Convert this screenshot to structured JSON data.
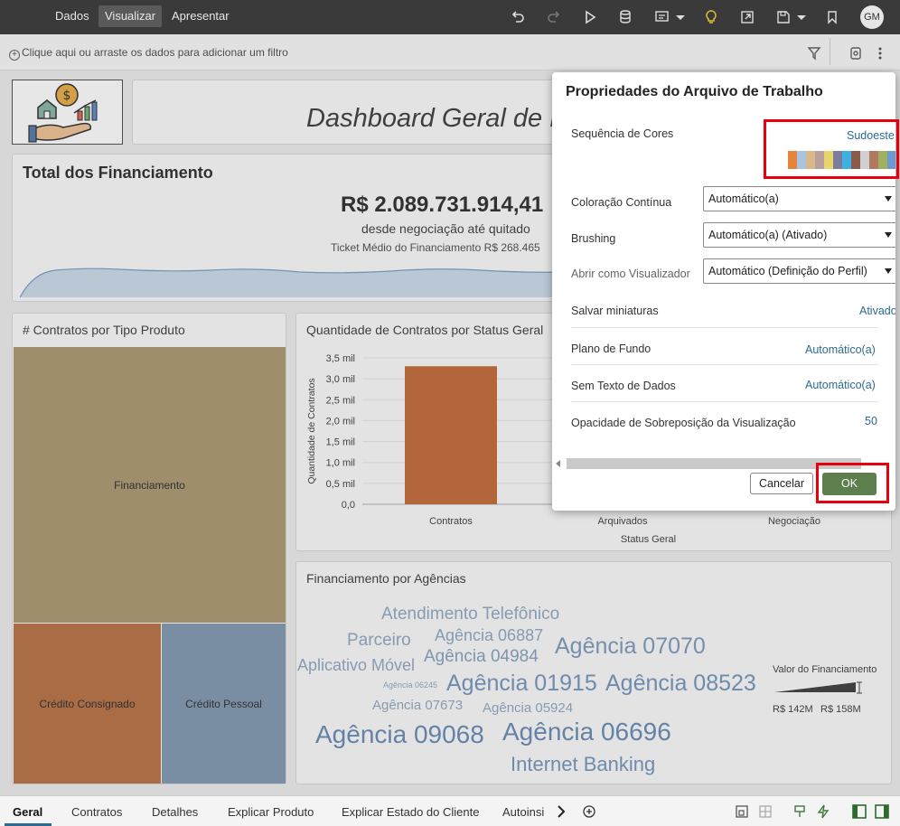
{
  "topbar": {
    "menus": [
      "Dados",
      "Visualizar",
      "Apresentar"
    ],
    "active_menu": "Visualizar",
    "avatar_initials": "GM",
    "icons": [
      "undo-icon",
      "redo-icon",
      "play-icon",
      "database-icon",
      "comment-icon",
      "lightbulb-icon",
      "export-icon",
      "save-icon",
      "bookmark-icon"
    ]
  },
  "filterbar": {
    "placeholder": "Clique aqui ou arraste os dados para adicionar um filtro"
  },
  "dashboard": {
    "title": "Dashboard Geral de F",
    "total": {
      "title": "Total dos Financiamento",
      "value": "R$ 2.089.731.914,41",
      "subtitle": "desde negociação até quitado",
      "ticket_label": "Ticket Médio do Financiamento",
      "ticket_value": "R$ 268.465"
    },
    "tipo_produto": {
      "title": "# Contratos por Tipo Produto",
      "cells": [
        "Financiamento",
        "Crédito Consignado",
        "Crédito Pessoal"
      ]
    },
    "agencias": {
      "title": "Financiamento por Agências",
      "words": [
        "Atendimento Telefônico",
        "Parceiro",
        "Agência 06887",
        "Agência 04984",
        "Agência 07070",
        "Aplicativo Móvel",
        "Agência 06245",
        "Agência 01915",
        "Agência 08523",
        "Agência 07673",
        "Agência 05924",
        "Agência 09068",
        "Agência 06696",
        "Internet Banking"
      ],
      "legend_title": "Valor do Financiamento",
      "legend_min": "R$ 142M",
      "legend_max": "R$ 158M"
    }
  },
  "chart_data": {
    "type": "bar",
    "title": "Quantidade de Contratos por Status Geral",
    "xlabel": "Status Geral",
    "ylabel": "Quantidade de Contratos",
    "categories": [
      "Contratos",
      "Arquivados",
      "Negociação"
    ],
    "values": [
      3300,
      null,
      null
    ],
    "yticks": [
      "0,0",
      "0,5 mil",
      "1,0 mil",
      "1,5 mil",
      "2,0 mil",
      "2,5 mil",
      "3,0 mil",
      "3,5 mil"
    ],
    "ylim": [
      0,
      3500
    ],
    "bar_color": "#c0622b"
  },
  "dialog": {
    "title": "Propriedades do Arquivo de Trabalho",
    "color_sequence_label": "Sequência de Cores",
    "color_sequence_value": "Sudoeste",
    "swatches": [
      "#e8843a",
      "#a8c4e0",
      "#d9b98a",
      "#b8a0a0",
      "#e8d66a",
      "#7c7c9c",
      "#3fb0e0",
      "#8a5a4a",
      "#d0d0d0",
      "#b07a60",
      "#a0b060",
      "#6a9ad0"
    ],
    "rows": [
      {
        "label": "Coloração Contínua",
        "value": "Automático(a)"
      },
      {
        "label": "Brushing",
        "value": "Automático(a) (Ativado)"
      },
      {
        "label": "Abrir como Visualizador",
        "value": "Automático (Definição do Perfil)"
      }
    ],
    "links": [
      {
        "label": "Salvar miniaturas",
        "value": "Ativado"
      },
      {
        "label": "Plano de Fundo",
        "value": "Automático(a)"
      },
      {
        "label": "Sem Texto de Dados",
        "value": "Automático(a)"
      },
      {
        "label": "Opacidade de Sobreposição da Visualização",
        "value": "50"
      }
    ],
    "cancel": "Cancelar",
    "ok": "OK"
  },
  "bottom_tabs": [
    "Geral",
    "Contratos",
    "Detalhes",
    "Explicar Produto",
    "Explicar Estado do Cliente",
    "Autoinsi"
  ],
  "colors": {
    "accent": "#2d6a8f",
    "ok_button": "#5d7f4e",
    "highlight": "#e8000f"
  }
}
